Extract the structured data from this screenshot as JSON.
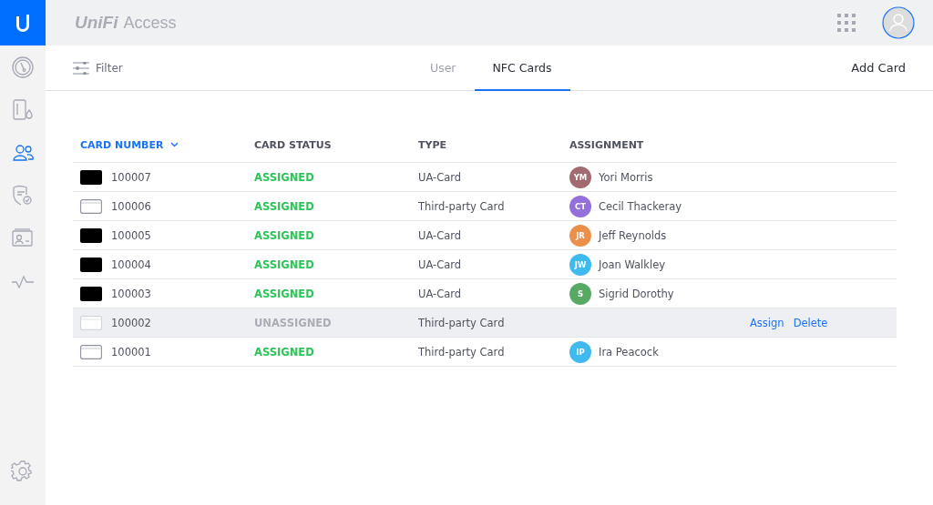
{
  "header": {
    "brand": "UniFi",
    "product": "Access"
  },
  "sidebar": {
    "items": [
      {
        "selected": false
      },
      {
        "selected": false
      },
      {
        "selected": true
      },
      {
        "selected": false
      },
      {
        "selected": false
      },
      {
        "selected": false
      }
    ],
    "bottom": [
      {
        "selected": false
      }
    ]
  },
  "toolbar": {
    "filter": "Filter",
    "tabs": [
      {
        "label": "User",
        "selected": false
      },
      {
        "label": "NFC Cards",
        "selected": true
      }
    ],
    "action": "Add Card"
  },
  "table": {
    "columns": [
      {
        "label": "CARD NUMBER",
        "sorted": true
      },
      {
        "label": "CARD STATUS",
        "sorted": false
      },
      {
        "label": "TYPE",
        "sorted": false
      },
      {
        "label": "ASSIGNMENT",
        "sorted": false
      }
    ],
    "rows": [
      {
        "kind": "ua",
        "number": "100007",
        "status": "ASSIGNED",
        "assigned": true,
        "type": "UA-Card",
        "initials": "YM",
        "color": "#a26b72",
        "name": "Yori Morris",
        "hovered": false
      },
      {
        "kind": "third-party",
        "number": "100006",
        "status": "ASSIGNED",
        "assigned": true,
        "type": "Third-party Card",
        "initials": "CT",
        "color": "#9370db",
        "name": "Cecil Thackeray",
        "hovered": false
      },
      {
        "kind": "ua",
        "number": "100005",
        "status": "ASSIGNED",
        "assigned": true,
        "type": "UA-Card",
        "initials": "JR",
        "color": "#ea904b",
        "name": "Jeff Reynolds",
        "hovered": false
      },
      {
        "kind": "ua",
        "number": "100004",
        "status": "ASSIGNED",
        "assigned": true,
        "type": "UA-Card",
        "initials": "JW",
        "color": "#3ebaee",
        "name": "Joan Walkley",
        "hovered": false
      },
      {
        "kind": "ua",
        "number": "100003",
        "status": "ASSIGNED",
        "assigned": true,
        "type": "UA-Card",
        "initials": "S",
        "color": "#58a964",
        "name": "Sigrid Dorothy",
        "hovered": false
      },
      {
        "kind": "third-party",
        "number": "100002",
        "status": "UNASSIGNED",
        "assigned": false,
        "type": "Third-party Card",
        "hovered": true,
        "actions": [
          "Assign",
          "Delete"
        ]
      },
      {
        "kind": "third-party",
        "number": "100001",
        "status": "ASSIGNED",
        "assigned": true,
        "type": "Third-party Card",
        "initials": "IP",
        "color": "#3ebaee",
        "name": "Ira Peacock",
        "hovered": false
      }
    ]
  }
}
